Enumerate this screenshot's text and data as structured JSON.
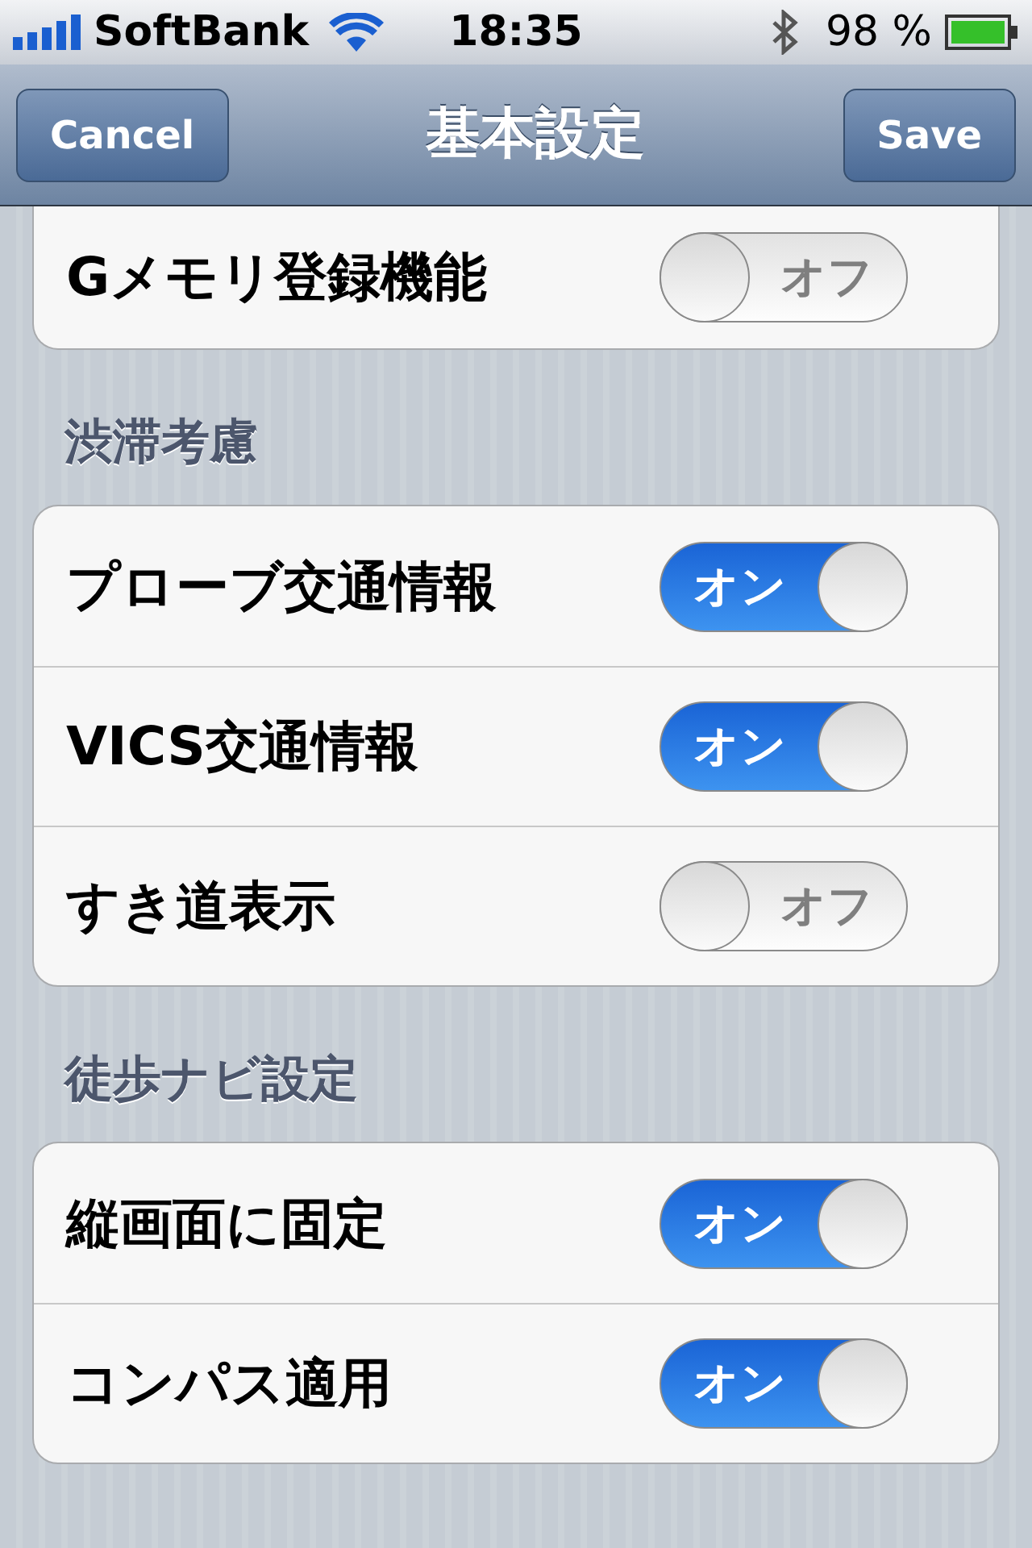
{
  "status_bar": {
    "carrier": "SoftBank",
    "time": "18:35",
    "battery": "98 %"
  },
  "nav_bar": {
    "cancel": "Cancel",
    "title": "基本設定",
    "save": "Save"
  },
  "groups": [
    {
      "rows": [
        {
          "label": "Gメモリ登録機能",
          "on": false,
          "switch_text": "オフ"
        }
      ]
    },
    {
      "header": "渋滞考慮",
      "rows": [
        {
          "label": "プローブ交通情報",
          "on": true,
          "switch_text": "オン"
        },
        {
          "label": "VICS交通情報",
          "on": true,
          "switch_text": "オン"
        },
        {
          "label": "すき道表示",
          "on": false,
          "switch_text": "オフ"
        }
      ]
    },
    {
      "header": "徒歩ナビ設定",
      "rows": [
        {
          "label": "縦画面に固定",
          "on": true,
          "switch_text": "オン"
        },
        {
          "label": "コンパス適用",
          "on": true,
          "switch_text": "オン"
        }
      ]
    }
  ]
}
